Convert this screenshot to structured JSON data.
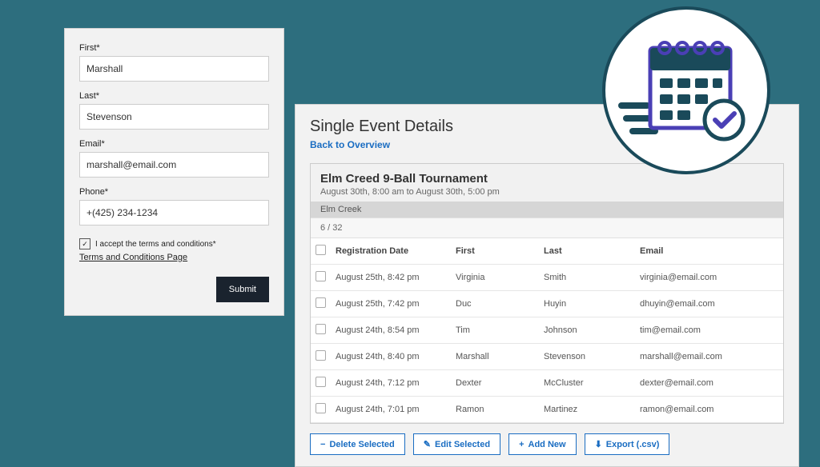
{
  "form": {
    "first_label": "First*",
    "first_value": "Marshall",
    "last_label": "Last*",
    "last_value": "Stevenson",
    "email_label": "Email*",
    "email_value": "marshall@email.com",
    "phone_label": "Phone*",
    "phone_value": "+(425) 234-1234",
    "terms_text": "I accept the terms and conditions*",
    "terms_link": "Terms and Conditions Page",
    "submit_label": "Submit"
  },
  "details": {
    "title": "Single Event Details",
    "back_link": "Back to Overview",
    "event_name": "Elm Creed 9-Ball Tournament",
    "event_time": "August 30th, 8:00 am to August 30th, 5:00 pm",
    "venue": "Elm Creek",
    "count": "6 / 32",
    "columns": {
      "date": "Registration Date",
      "first": "First",
      "last": "Last",
      "email": "Email"
    },
    "rows": [
      {
        "date": "August 25th, 8:42 pm",
        "first": "Virginia",
        "last": "Smith",
        "email": "virginia@email.com"
      },
      {
        "date": "August 25th, 7:42 pm",
        "first": "Duc",
        "last": "Huyin",
        "email": "dhuyin@email.com"
      },
      {
        "date": "August 24th, 8:54 pm",
        "first": "Tim",
        "last": "Johnson",
        "email": "tim@email.com"
      },
      {
        "date": "August 24th, 8:40 pm",
        "first": "Marshall",
        "last": "Stevenson",
        "email": "marshall@email.com"
      },
      {
        "date": "August 24th, 7:12 pm",
        "first": "Dexter",
        "last": "McCluster",
        "email": "dexter@email.com"
      },
      {
        "date": "August 24th, 7:01 pm",
        "first": "Ramon",
        "last": "Martinez",
        "email": "ramon@email.com"
      }
    ],
    "actions": {
      "delete": "Delete Selected",
      "edit": "Edit Selected",
      "add": "Add New",
      "export": "Export (.csv)"
    }
  }
}
